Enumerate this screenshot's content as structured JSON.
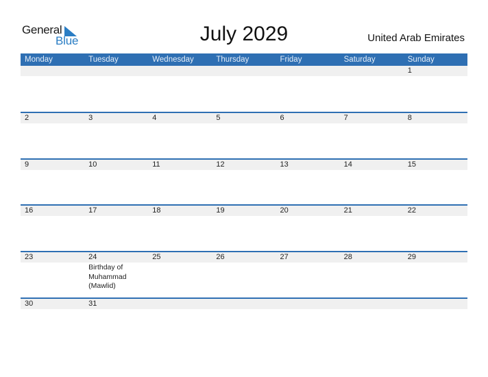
{
  "logo": {
    "word1": "General",
    "word2": "Blue"
  },
  "title": "July 2029",
  "country": "United Arab Emirates",
  "colors": {
    "header_bg": "#2e6fb3",
    "band_bg": "#f0f0f0",
    "logo_blue": "#2a7dc4"
  },
  "weekdays": [
    "Monday",
    "Tuesday",
    "Wednesday",
    "Thursday",
    "Friday",
    "Saturday",
    "Sunday"
  ],
  "weeks": [
    {
      "days": [
        "",
        "",
        "",
        "",
        "",
        "",
        "1"
      ],
      "events": [
        "",
        "",
        "",
        "",
        "",
        "",
        ""
      ]
    },
    {
      "days": [
        "2",
        "3",
        "4",
        "5",
        "6",
        "7",
        "8"
      ],
      "events": [
        "",
        "",
        "",
        "",
        "",
        "",
        ""
      ]
    },
    {
      "days": [
        "9",
        "10",
        "11",
        "12",
        "13",
        "14",
        "15"
      ],
      "events": [
        "",
        "",
        "",
        "",
        "",
        "",
        ""
      ]
    },
    {
      "days": [
        "16",
        "17",
        "18",
        "19",
        "20",
        "21",
        "22"
      ],
      "events": [
        "",
        "",
        "",
        "",
        "",
        "",
        ""
      ]
    },
    {
      "days": [
        "23",
        "24",
        "25",
        "26",
        "27",
        "28",
        "29"
      ],
      "events": [
        "",
        "Birthday of Muhammad (Mawlid)",
        "",
        "",
        "",
        "",
        ""
      ]
    },
    {
      "days": [
        "30",
        "31",
        "",
        "",
        "",
        "",
        ""
      ],
      "events": [
        "",
        "",
        "",
        "",
        "",
        "",
        ""
      ]
    }
  ]
}
